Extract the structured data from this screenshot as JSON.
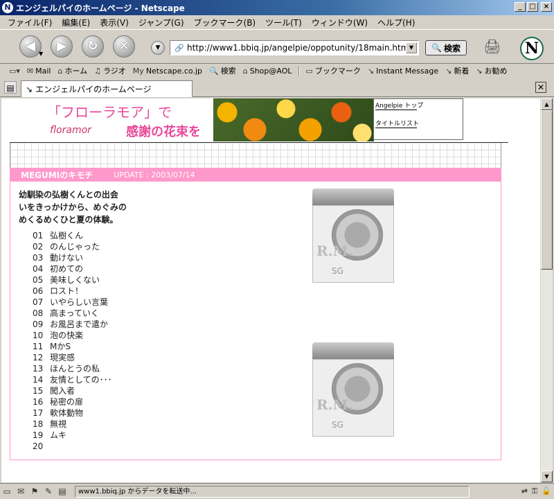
{
  "window": {
    "title": "エンジェルパイのホームページ - Netscape",
    "app_icon": "netscape-n-icon",
    "controls": [
      "_",
      "□",
      "×"
    ]
  },
  "menubar": {
    "items": [
      "ファイル(F)",
      "編集(E)",
      "表示(V)",
      "ジャンプ(G)",
      "ブックマーク(B)",
      "ツール(T)",
      "ウィンドウ(W)",
      "ヘルプ(H)"
    ]
  },
  "navbar": {
    "back_icon": "back-arrow-icon",
    "url": "http://www1.bbiq.jp/angelpie/oppotunity/18main.html",
    "search_label": "検索"
  },
  "personal_toolbar": {
    "items": [
      {
        "label": "Mail",
        "icon": "mail-icon"
      },
      {
        "label": "ホーム",
        "icon": "home-icon"
      },
      {
        "label": "ラジオ",
        "icon": "radio-icon"
      },
      {
        "label": "Netscape.co.jp",
        "icon": "my-netscape-icon"
      },
      {
        "label": "検索",
        "icon": "search-icon"
      },
      {
        "label": "Shop@AOL",
        "icon": "shop-icon"
      },
      {
        "label": "ブックマーク",
        "icon": "bookmark-folder-icon"
      },
      {
        "label": "Instant Message",
        "icon": "link-icon"
      },
      {
        "label": "新着",
        "icon": "link-icon"
      },
      {
        "label": "お勧め",
        "icon": "link-icon"
      }
    ]
  },
  "tab": {
    "title": "エンジェルパイのホームページ"
  },
  "page": {
    "banner": {
      "line1": "「フローラモア」で",
      "line2": "感謝の花束を",
      "logo": "floramor"
    },
    "sidelinks": [
      "Angelpie トップ",
      "タイトルリスト"
    ],
    "header": {
      "title": "MEGUMIのキモチ",
      "update": "UPDATE : 2003/07/14"
    },
    "intro": [
      "幼馴染の弘樹くんとの出会",
      "いをきっかけから、めぐみの",
      "めくるめくひと夏の体験。"
    ],
    "chapters": [
      {
        "num": "01",
        "title": "弘樹くん"
      },
      {
        "num": "02",
        "title": "のんじゃった"
      },
      {
        "num": "03",
        "title": "動けない"
      },
      {
        "num": "04",
        "title": "初めての"
      },
      {
        "num": "05",
        "title": "美味しくない"
      },
      {
        "num": "06",
        "title": "ロスト！"
      },
      {
        "num": "07",
        "title": "いやらしい言葉"
      },
      {
        "num": "08",
        "title": "高まっていく"
      },
      {
        "num": "09",
        "title": "お風呂まで遣か"
      },
      {
        "num": "10",
        "title": "泡の快楽"
      },
      {
        "num": "11",
        "title": "MかS"
      },
      {
        "num": "12",
        "title": "現実感"
      },
      {
        "num": "13",
        "title": "ほんとうの私"
      },
      {
        "num": "14",
        "title": "友情としての･･･"
      },
      {
        "num": "15",
        "title": "闖入者"
      },
      {
        "num": "16",
        "title": "秘密の扉"
      },
      {
        "num": "17",
        "title": "軟体動物"
      },
      {
        "num": "18",
        "title": "無視"
      },
      {
        "num": "19",
        "title": "ムキ"
      },
      {
        "num": "20",
        "title": ""
      }
    ],
    "products": [
      {
        "label": "R.M.",
        "sub": "SG"
      },
      {
        "label": "R.M.",
        "sub": "SG"
      }
    ]
  },
  "statusbar": {
    "text": "www1.bbiq.jp からデータを転送中..."
  },
  "colors": {
    "pink": "#ff99cc",
    "banner_text": "#e8489a",
    "title_bar": "#0a246a"
  }
}
